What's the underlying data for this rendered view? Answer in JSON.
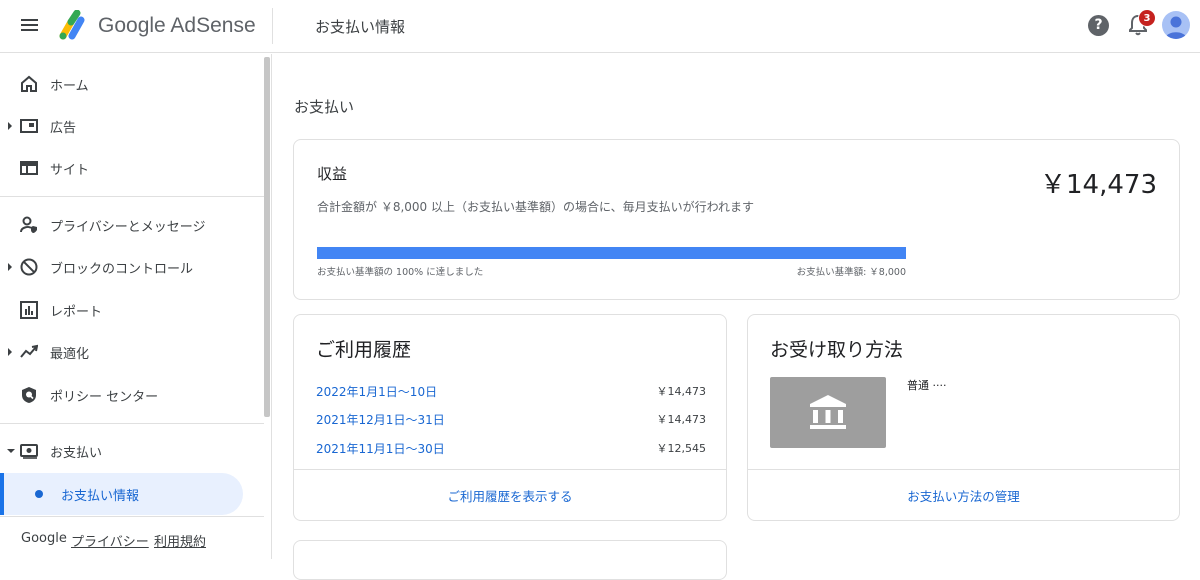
{
  "header": {
    "brand": "Google AdSense",
    "page_title": "お支払い情報",
    "help_label": "?",
    "notification_count": "3",
    "icons": {
      "menu": "menu-icon",
      "help": "help-icon",
      "notifications": "bell-icon",
      "account": "avatar"
    }
  },
  "sidebar": {
    "items": [
      {
        "label": "ホーム",
        "icon": "home-icon"
      },
      {
        "label": "広告",
        "icon": "ads-icon"
      },
      {
        "label": "サイト",
        "icon": "sites-icon"
      },
      {
        "label": "プライバシーとメッセージ",
        "icon": "privacy-icon"
      },
      {
        "label": "ブロックのコントロール",
        "icon": "block-icon"
      },
      {
        "label": "レポート",
        "icon": "reports-icon"
      },
      {
        "label": "最適化",
        "icon": "optimization-icon"
      },
      {
        "label": "ポリシー センター",
        "icon": "policy-icon"
      },
      {
        "label": "お支払い",
        "icon": "payments-icon"
      }
    ],
    "active_sub": "お支払い情報",
    "footer": {
      "google": "Google",
      "privacy": "プライバシー",
      "terms": "利用規約"
    }
  },
  "main": {
    "section_title": "お支払い",
    "earnings": {
      "title": "収益",
      "description": "合計金額が ￥8,000 以上（お支払い基準額）の場合に、毎月支払いが行われます",
      "amount": "￥14,473",
      "progress_percent": 100,
      "progress_left": "お支払い基準額の 100% に達しました",
      "progress_right": "お支払い基準額: ￥8,000"
    },
    "history": {
      "title": "ご利用履歴",
      "rows": [
        {
          "date": "2022年1月1日～10日",
          "amount": "￥14,473"
        },
        {
          "date": "2021年12月1日～31日",
          "amount": "￥14,473"
        },
        {
          "date": "2021年11月1日～30日",
          "amount": "￥12,545"
        }
      ],
      "footer_link": "ご利用履歴を表示する"
    },
    "payment_method": {
      "title": "お受け取り方法",
      "bank_icon": "bank-icon",
      "account_name": "普通 ····",
      "footer_link": "お支払い方法の管理"
    }
  },
  "colors": {
    "accent": "#1a73e8",
    "link": "#1967d2",
    "progress": "#4285f4",
    "badge": "#c5221f"
  }
}
